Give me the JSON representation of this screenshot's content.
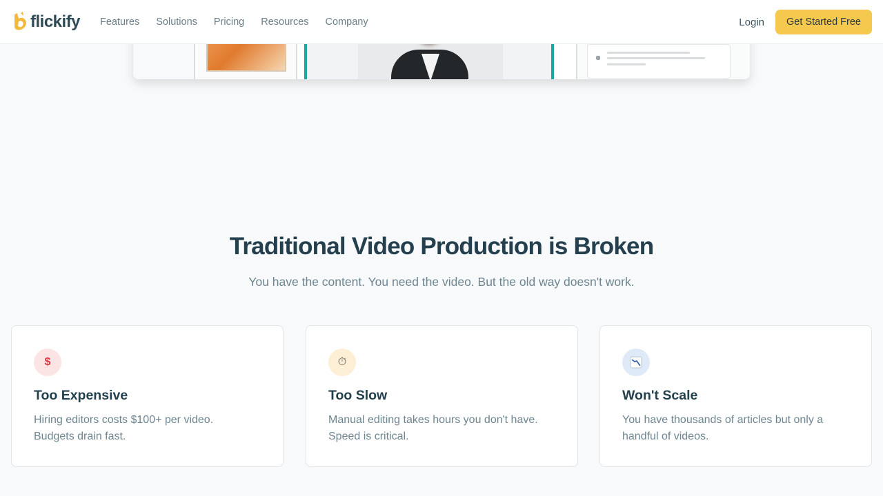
{
  "nav": {
    "logo_text": "flickify",
    "links": [
      "Features",
      "Solutions",
      "Pricing",
      "Resources",
      "Company"
    ],
    "login_label": "Login",
    "cta_label": "Get Started Free"
  },
  "colors": {
    "accent": "#f5c84e",
    "heading": "#24404e",
    "muted": "#6d8591",
    "teal": "#19a7a0"
  },
  "section": {
    "title": "Traditional Video Production is Broken",
    "subtitle": "You have the content. You need the video. But the old way doesn't work."
  },
  "cards": [
    {
      "icon": "dollar-icon",
      "glyph": "$",
      "title": "Too Expensive",
      "text": "Hiring editors costs $100+ per video. Budgets drain fast."
    },
    {
      "icon": "stopwatch-icon",
      "glyph": "⏱",
      "title": "Too Slow",
      "text": "Manual editing takes hours you don't have. Speed is critical."
    },
    {
      "icon": "chart-decreasing-icon",
      "glyph": "📉",
      "title": "Won't Scale",
      "text": "You have thousands of articles but only a handful of videos."
    }
  ]
}
